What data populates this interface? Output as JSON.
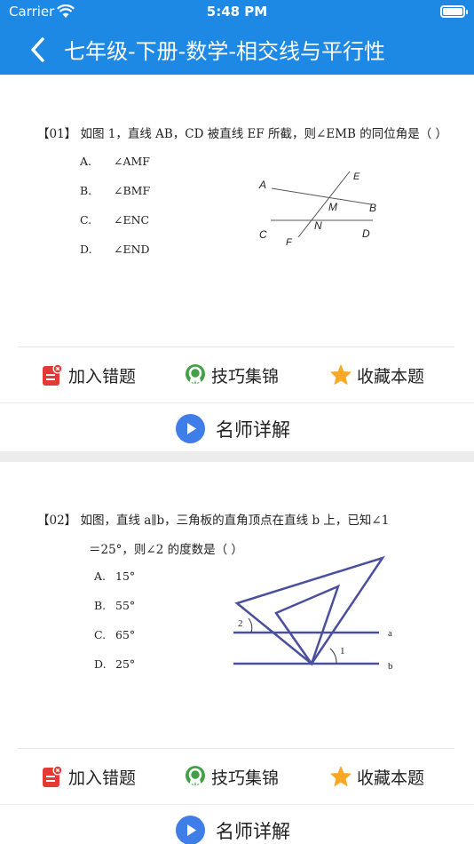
{
  "status_bar": {
    "carrier": "Carrier",
    "time": "5:48 PM"
  },
  "nav": {
    "title": "七年级-下册-数学-相交线与平行性",
    "back_icon": "chevron-left-icon"
  },
  "colors": {
    "primary": "#1E88E5",
    "error_red": "#E53935",
    "tips_green": "#43A047",
    "star": "#F9A825",
    "play": "#3F7DE8"
  },
  "questions": [
    {
      "line1": "【01】 如图 1，直线 AB，CD 被直线 EF 所截，则∠EMB 的同位角是（    ）",
      "line2": "",
      "options": [
        {
          "letter": "A.",
          "text": "∠AMF"
        },
        {
          "letter": "B.",
          "text": "∠BMF"
        },
        {
          "letter": "C.",
          "text": "∠ENC"
        },
        {
          "letter": "D.",
          "text": "∠END"
        }
      ],
      "figure_labels": {
        "A": "A",
        "B": "B",
        "C": "C",
        "D": "D",
        "E": "E",
        "F": "F",
        "M": "M",
        "N": "N"
      }
    },
    {
      "line1": "【02】 如图，直线 a∥b，三角板的直角顶点在直线 b 上，已知∠1",
      "line2": "＝25°，则∠2 的度数是（        ）",
      "options": [
        {
          "letter": "A.",
          "text": "15°"
        },
        {
          "letter": "B.",
          "text": "55°"
        },
        {
          "letter": "C.",
          "text": "65°"
        },
        {
          "letter": "D.",
          "text": "25°"
        }
      ],
      "figure_labels": {
        "a": "a",
        "b": "b",
        "one": "1",
        "two": "2"
      }
    }
  ],
  "actions": {
    "add_error": "加入错题",
    "tips": "技巧集锦",
    "favorite": "收藏本题",
    "explain": "名师详解"
  }
}
